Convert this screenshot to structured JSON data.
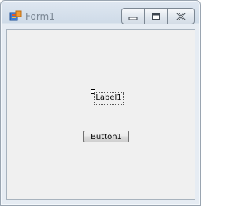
{
  "window": {
    "title": "Form1",
    "icon": "form-icon",
    "caption_buttons": [
      "minimize",
      "maximize",
      "close"
    ]
  },
  "form": {
    "label_text": "Label1",
    "button_text": "Button1"
  },
  "colors": {
    "client_background": "#f0f0f0",
    "titlebar": "#dfe7f1"
  }
}
